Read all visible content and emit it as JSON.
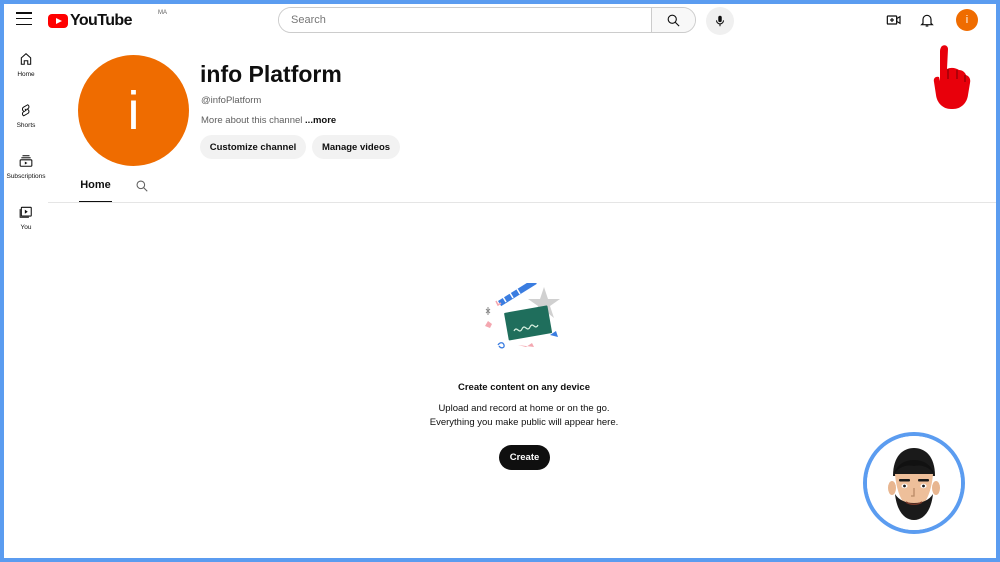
{
  "app": {
    "logo_text": "YouTube",
    "country_code": "MA",
    "brand_color": "#ff0000",
    "accent_color": "#ef6c00"
  },
  "header": {
    "search_placeholder": "Search",
    "icons": [
      "menu-icon",
      "search-icon",
      "mic-icon",
      "create-video-icon",
      "bell-icon"
    ],
    "avatar_letter": "i"
  },
  "sidebar": {
    "items": [
      {
        "label": "Home",
        "icon": "home-icon"
      },
      {
        "label": "Shorts",
        "icon": "shorts-icon"
      },
      {
        "label": "Subscriptions",
        "icon": "subscriptions-icon"
      },
      {
        "label": "You",
        "icon": "you-icon"
      }
    ]
  },
  "channel": {
    "avatar_letter": "i",
    "name": "info Platform",
    "handle": "@infoPlatform",
    "description": "More about this channel",
    "more_label": "...more",
    "buttons": {
      "customize": "Customize channel",
      "manage": "Manage videos"
    },
    "tabs": [
      {
        "label": "Home",
        "active": true
      }
    ]
  },
  "empty_state": {
    "title": "Create content on any device",
    "line1": "Upload and record at home or on the go.",
    "line2": "Everything you make public will appear here.",
    "create_label": "Create"
  }
}
